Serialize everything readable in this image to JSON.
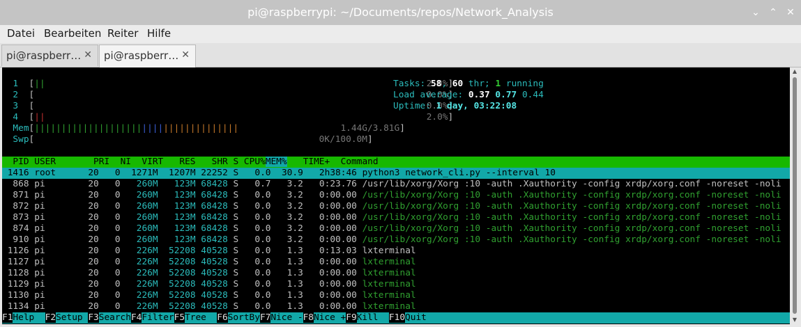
{
  "window": {
    "title": "pi@raspberrypi: ~/Documents/repos/Network_Analysis"
  },
  "window_controls": {
    "minimize": "⌄",
    "maximize": "⌃",
    "close": "✕"
  },
  "menu": [
    "Datei",
    "Bearbeiten",
    "Reiter",
    "Hilfe"
  ],
  "tabs": [
    {
      "label": "pi@raspberr…",
      "close": "✕"
    },
    {
      "label": "pi@raspberr…",
      "close": "✕"
    }
  ],
  "meters": {
    "cpu": [
      {
        "num": "1",
        "bar": "||",
        "value": "2.0%"
      },
      {
        "num": "2",
        "bar": "",
        "value": "0.0%"
      },
      {
        "num": "3",
        "bar": "",
        "value": "0.0%"
      },
      {
        "num": "4",
        "bar": "||",
        "value": "2.0%"
      }
    ],
    "mem": {
      "label": "Mem",
      "bar_green": "||||||||||||||||||||",
      "bar_blue": "||||",
      "bar_yellow": "||||||||||||||",
      "value": "1.44G/3.81G"
    },
    "swp": {
      "label": "Swp",
      "value": "0K/100.0M"
    }
  },
  "summary": {
    "tasks_label": "Tasks: ",
    "tasks": "58",
    "sep": ", ",
    "thr": "60",
    "thr_label": " thr; ",
    "running": "1",
    "running_label": " running",
    "load_label": "Load average: ",
    "load1": "0.37",
    "load5": "0.77",
    "load15": "0.44",
    "uptime_label": "Uptime: ",
    "uptime": "1 day, 03:22:08"
  },
  "columns": [
    "PID",
    "USER",
    "PRI",
    "NI",
    "VIRT",
    "RES",
    "SHR",
    "S",
    "CPU%",
    "MEM%",
    "TIME+",
    "Command"
  ],
  "processes": [
    {
      "pid": "1416",
      "user": "root",
      "pri": "20",
      "ni": "0",
      "virt": "1271M",
      "res": "1207M",
      "shr": "22252",
      "s": "S",
      "cpu": "0.0",
      "mem": "30.9",
      "time": "2h38:46",
      "cmd": "python3 network_cli.py --interval 10"
    },
    {
      "pid": "868",
      "user": "pi",
      "pri": "20",
      "ni": "0",
      "virt": "260M",
      "res": "123M",
      "shr": "68428",
      "s": "S",
      "cpu": "0.7",
      "mem": "3.2",
      "time": "0:23.76",
      "cmd": "/usr/lib/xorg/Xorg :10 -auth .Xauthority -config xrdp/xorg.conf -noreset -noli"
    },
    {
      "pid": "871",
      "user": "pi",
      "pri": "20",
      "ni": "0",
      "virt": "260M",
      "res": "123M",
      "shr": "68428",
      "s": "S",
      "cpu": "0.0",
      "mem": "3.2",
      "time": "0:00.00",
      "cmd": "/usr/lib/xorg/Xorg :10 -auth .Xauthority -config xrdp/xorg.conf -noreset -noli"
    },
    {
      "pid": "872",
      "user": "pi",
      "pri": "20",
      "ni": "0",
      "virt": "260M",
      "res": "123M",
      "shr": "68428",
      "s": "S",
      "cpu": "0.0",
      "mem": "3.2",
      "time": "0:00.00",
      "cmd": "/usr/lib/xorg/Xorg :10 -auth .Xauthority -config xrdp/xorg.conf -noreset -noli"
    },
    {
      "pid": "873",
      "user": "pi",
      "pri": "20",
      "ni": "0",
      "virt": "260M",
      "res": "123M",
      "shr": "68428",
      "s": "S",
      "cpu": "0.0",
      "mem": "3.2",
      "time": "0:00.00",
      "cmd": "/usr/lib/xorg/Xorg :10 -auth .Xauthority -config xrdp/xorg.conf -noreset -noli"
    },
    {
      "pid": "874",
      "user": "pi",
      "pri": "20",
      "ni": "0",
      "virt": "260M",
      "res": "123M",
      "shr": "68428",
      "s": "S",
      "cpu": "0.0",
      "mem": "3.2",
      "time": "0:00.00",
      "cmd": "/usr/lib/xorg/Xorg :10 -auth .Xauthority -config xrdp/xorg.conf -noreset -noli"
    },
    {
      "pid": "910",
      "user": "pi",
      "pri": "20",
      "ni": "0",
      "virt": "260M",
      "res": "123M",
      "shr": "68428",
      "s": "S",
      "cpu": "0.0",
      "mem": "3.2",
      "time": "0:00.00",
      "cmd": "/usr/lib/xorg/Xorg :10 -auth .Xauthority -config xrdp/xorg.conf -noreset -noli"
    },
    {
      "pid": "1126",
      "user": "pi",
      "pri": "20",
      "ni": "0",
      "virt": "226M",
      "res": "52208",
      "shr": "40528",
      "s": "S",
      "cpu": "0.0",
      "mem": "1.3",
      "time": "0:13.03",
      "cmd": "lxterminal"
    },
    {
      "pid": "1127",
      "user": "pi",
      "pri": "20",
      "ni": "0",
      "virt": "226M",
      "res": "52208",
      "shr": "40528",
      "s": "S",
      "cpu": "0.0",
      "mem": "1.3",
      "time": "0:00.00",
      "cmd": "lxterminal"
    },
    {
      "pid": "1128",
      "user": "pi",
      "pri": "20",
      "ni": "0",
      "virt": "226M",
      "res": "52208",
      "shr": "40528",
      "s": "S",
      "cpu": "0.0",
      "mem": "1.3",
      "time": "0:00.00",
      "cmd": "lxterminal"
    },
    {
      "pid": "1129",
      "user": "pi",
      "pri": "20",
      "ni": "0",
      "virt": "226M",
      "res": "52208",
      "shr": "40528",
      "s": "S",
      "cpu": "0.0",
      "mem": "1.3",
      "time": "0:00.00",
      "cmd": "lxterminal"
    },
    {
      "pid": "1130",
      "user": "pi",
      "pri": "20",
      "ni": "0",
      "virt": "226M",
      "res": "52208",
      "shr": "40528",
      "s": "S",
      "cpu": "0.0",
      "mem": "1.3",
      "time": "0:00.00",
      "cmd": "lxterminal"
    },
    {
      "pid": "1134",
      "user": "pi",
      "pri": "20",
      "ni": "0",
      "virt": "226M",
      "res": "52208",
      "shr": "40528",
      "s": "S",
      "cpu": "0.0",
      "mem": "1.3",
      "time": "0:00.00",
      "cmd": "lxterminal"
    }
  ],
  "fkeys": [
    {
      "key": "F1",
      "label": "Help  "
    },
    {
      "key": "F2",
      "label": "Setup "
    },
    {
      "key": "F3",
      "label": "Search"
    },
    {
      "key": "F4",
      "label": "Filter"
    },
    {
      "key": "F5",
      "label": "Tree  "
    },
    {
      "key": "F6",
      "label": "SortBy"
    },
    {
      "key": "F7",
      "label": "Nice -"
    },
    {
      "key": "F8",
      "label": "Nice +"
    },
    {
      "key": "F9",
      "label": "Kill  "
    },
    {
      "key": "F10",
      "label": "Quit"
    }
  ],
  "colors": {
    "header_bg": "#17b800",
    "selection_bg": "#12a8a8",
    "terminal_bg": "#000000",
    "titlebar_bg": "#c4c4c4"
  }
}
